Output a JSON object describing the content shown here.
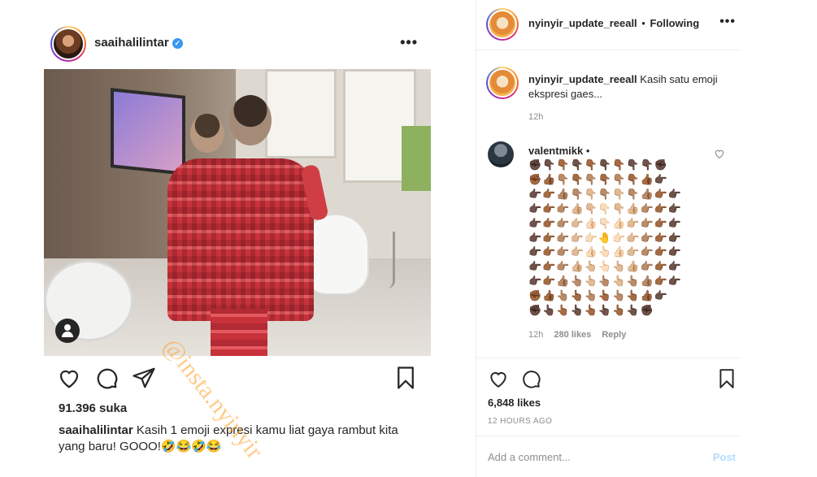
{
  "left_post": {
    "username": "saaihalilintar",
    "likes": "91.396 suka",
    "caption_user": "saaihalilintar",
    "caption_text": "Kasih 1 emoji expresi kamu liat gaya rambut kita yang baru! GOOO!🤣😂🤣😂",
    "watermark": "@insta.nyinyir"
  },
  "panel": {
    "header_user": "nyinyir_update_reeall",
    "header_sep": "•",
    "following_label": "Following",
    "owner_comment_user": "nyinyir_update_reeall",
    "owner_comment_text": "Kasih satu emoji ekspresi gaes...",
    "owner_comment_time": "12h",
    "comment2_user": "valentmikk",
    "comment2_sep": "•",
    "comment2_emoji_rows": [
      "✊🏿👇🏿👇🏾👇🏿👇🏾👇🏿👇🏾👇🏿👇🏿✊🏿",
      "✊🏾👍🏾👇🏽👇🏾👇🏽👇🏾👇🏽👇🏾👍🏾👉🏿",
      "👉🏿👉🏾👍🏽👇🏽👇🏼👇🏽👇🏼👇🏽👍🏽👉🏾👉🏿",
      "👉🏿👉🏾👉🏽👍🏼👇🏼👇🏻👇🏼👍🏼👉🏽👉🏾👉🏿",
      "👉🏿👉🏾👉🏽👉🏼👍🏻👇🏻👍🏻👉🏼👉🏽👉🏾👉🏿",
      "👉🏿👉🏾👉🏽👉🏼👉🏻🤚👉🏻👉🏼👉🏽👉🏾👉🏿",
      "👉🏿👉🏾👉🏽👉🏼👍🏻👆🏻👍🏻👉🏼👉🏽👉🏾👉🏿",
      "👉🏿👉🏾👉🏽👍🏼👆🏼👆🏻👆🏼👍🏼👉🏽👉🏾👉🏿",
      "👉🏿👉🏾👍🏽👆🏽👆🏼👆🏽👆🏼👆🏽👍🏽👉🏾👉🏿",
      "✊🏾👍🏾👆🏽👆🏾👆🏽👆🏾👆🏽👆🏾👍🏾👉🏿",
      "✊🏿👆🏿👆🏾👆🏿👆🏾👆🏿👆🏾👆🏿✊🏿"
    ],
    "comment2_time": "12h",
    "comment2_likes": "280 likes",
    "comment2_reply": "Reply",
    "total_likes": "6,848 likes",
    "time_ago": "12 HOURS AGO",
    "add_comment_placeholder": "Add a comment...",
    "post_label": "Post"
  },
  "icons": {
    "heart": "heart-icon",
    "comment": "comment-icon",
    "share": "share-icon",
    "bookmark": "bookmark-icon",
    "more": "more-icon",
    "verified": "verified-icon"
  },
  "colors": {
    "text": "#262626",
    "muted": "#8e8e8e",
    "verified_blue": "#3897f0",
    "post_disabled": "#b3dbff",
    "divider": "#efefef"
  }
}
